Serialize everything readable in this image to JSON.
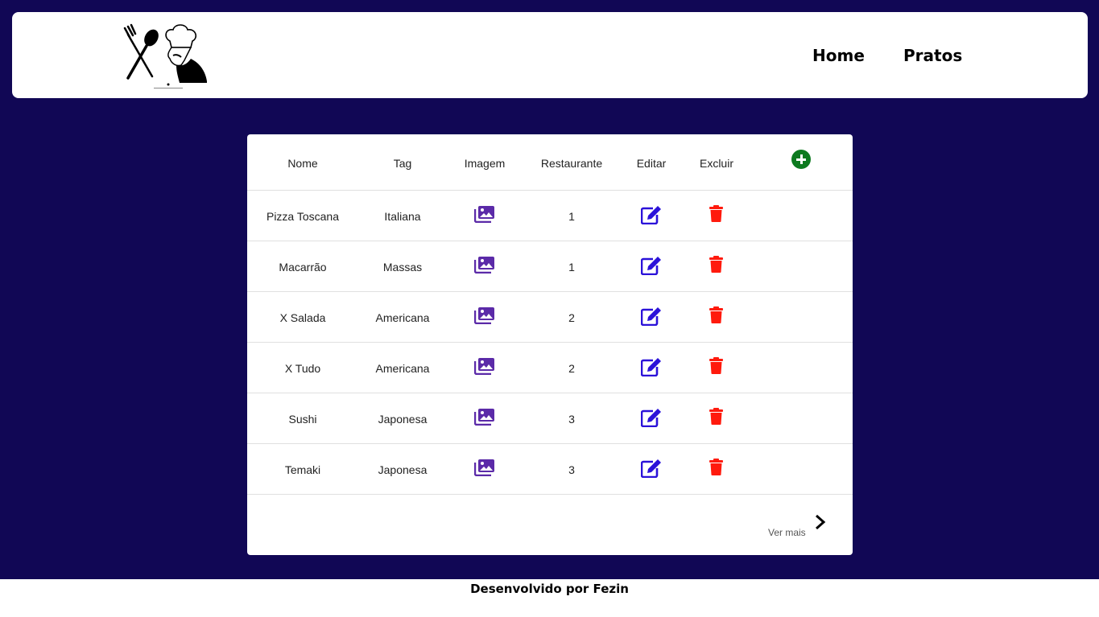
{
  "header": {
    "nav": {
      "home": "Home",
      "pratos": "Pratos"
    }
  },
  "table": {
    "columns": {
      "nome": "Nome",
      "tag": "Tag",
      "imagem": "Imagem",
      "restaurante": "Restaurante",
      "editar": "Editar",
      "excluir": "Excluir"
    },
    "rows": [
      {
        "nome": "Pizza Toscana",
        "tag": "Italiana",
        "restaurante": "1"
      },
      {
        "nome": "Macarrão",
        "tag": "Massas",
        "restaurante": "1"
      },
      {
        "nome": "X Salada",
        "tag": "Americana",
        "restaurante": "2"
      },
      {
        "nome": "X Tudo",
        "tag": "Americana",
        "restaurante": "2"
      },
      {
        "nome": "Sushi",
        "tag": "Japonesa",
        "restaurante": "3"
      },
      {
        "nome": "Temaki",
        "tag": "Japonesa",
        "restaurante": "3"
      }
    ],
    "more_label": "Ver mais"
  },
  "footer": {
    "text": "Desenvolvido por Fezin"
  },
  "icons": {
    "image": "images-icon",
    "edit": "edit-icon",
    "delete": "trash-icon",
    "add": "plus-circle-icon",
    "more": "chevron-right-icon"
  },
  "colors": {
    "background": "#110755",
    "image_icon": "#5b2aa8",
    "edit_icon": "#2b12d9",
    "delete_icon": "#ff1a0d",
    "add_icon": "#0d7a1f"
  }
}
